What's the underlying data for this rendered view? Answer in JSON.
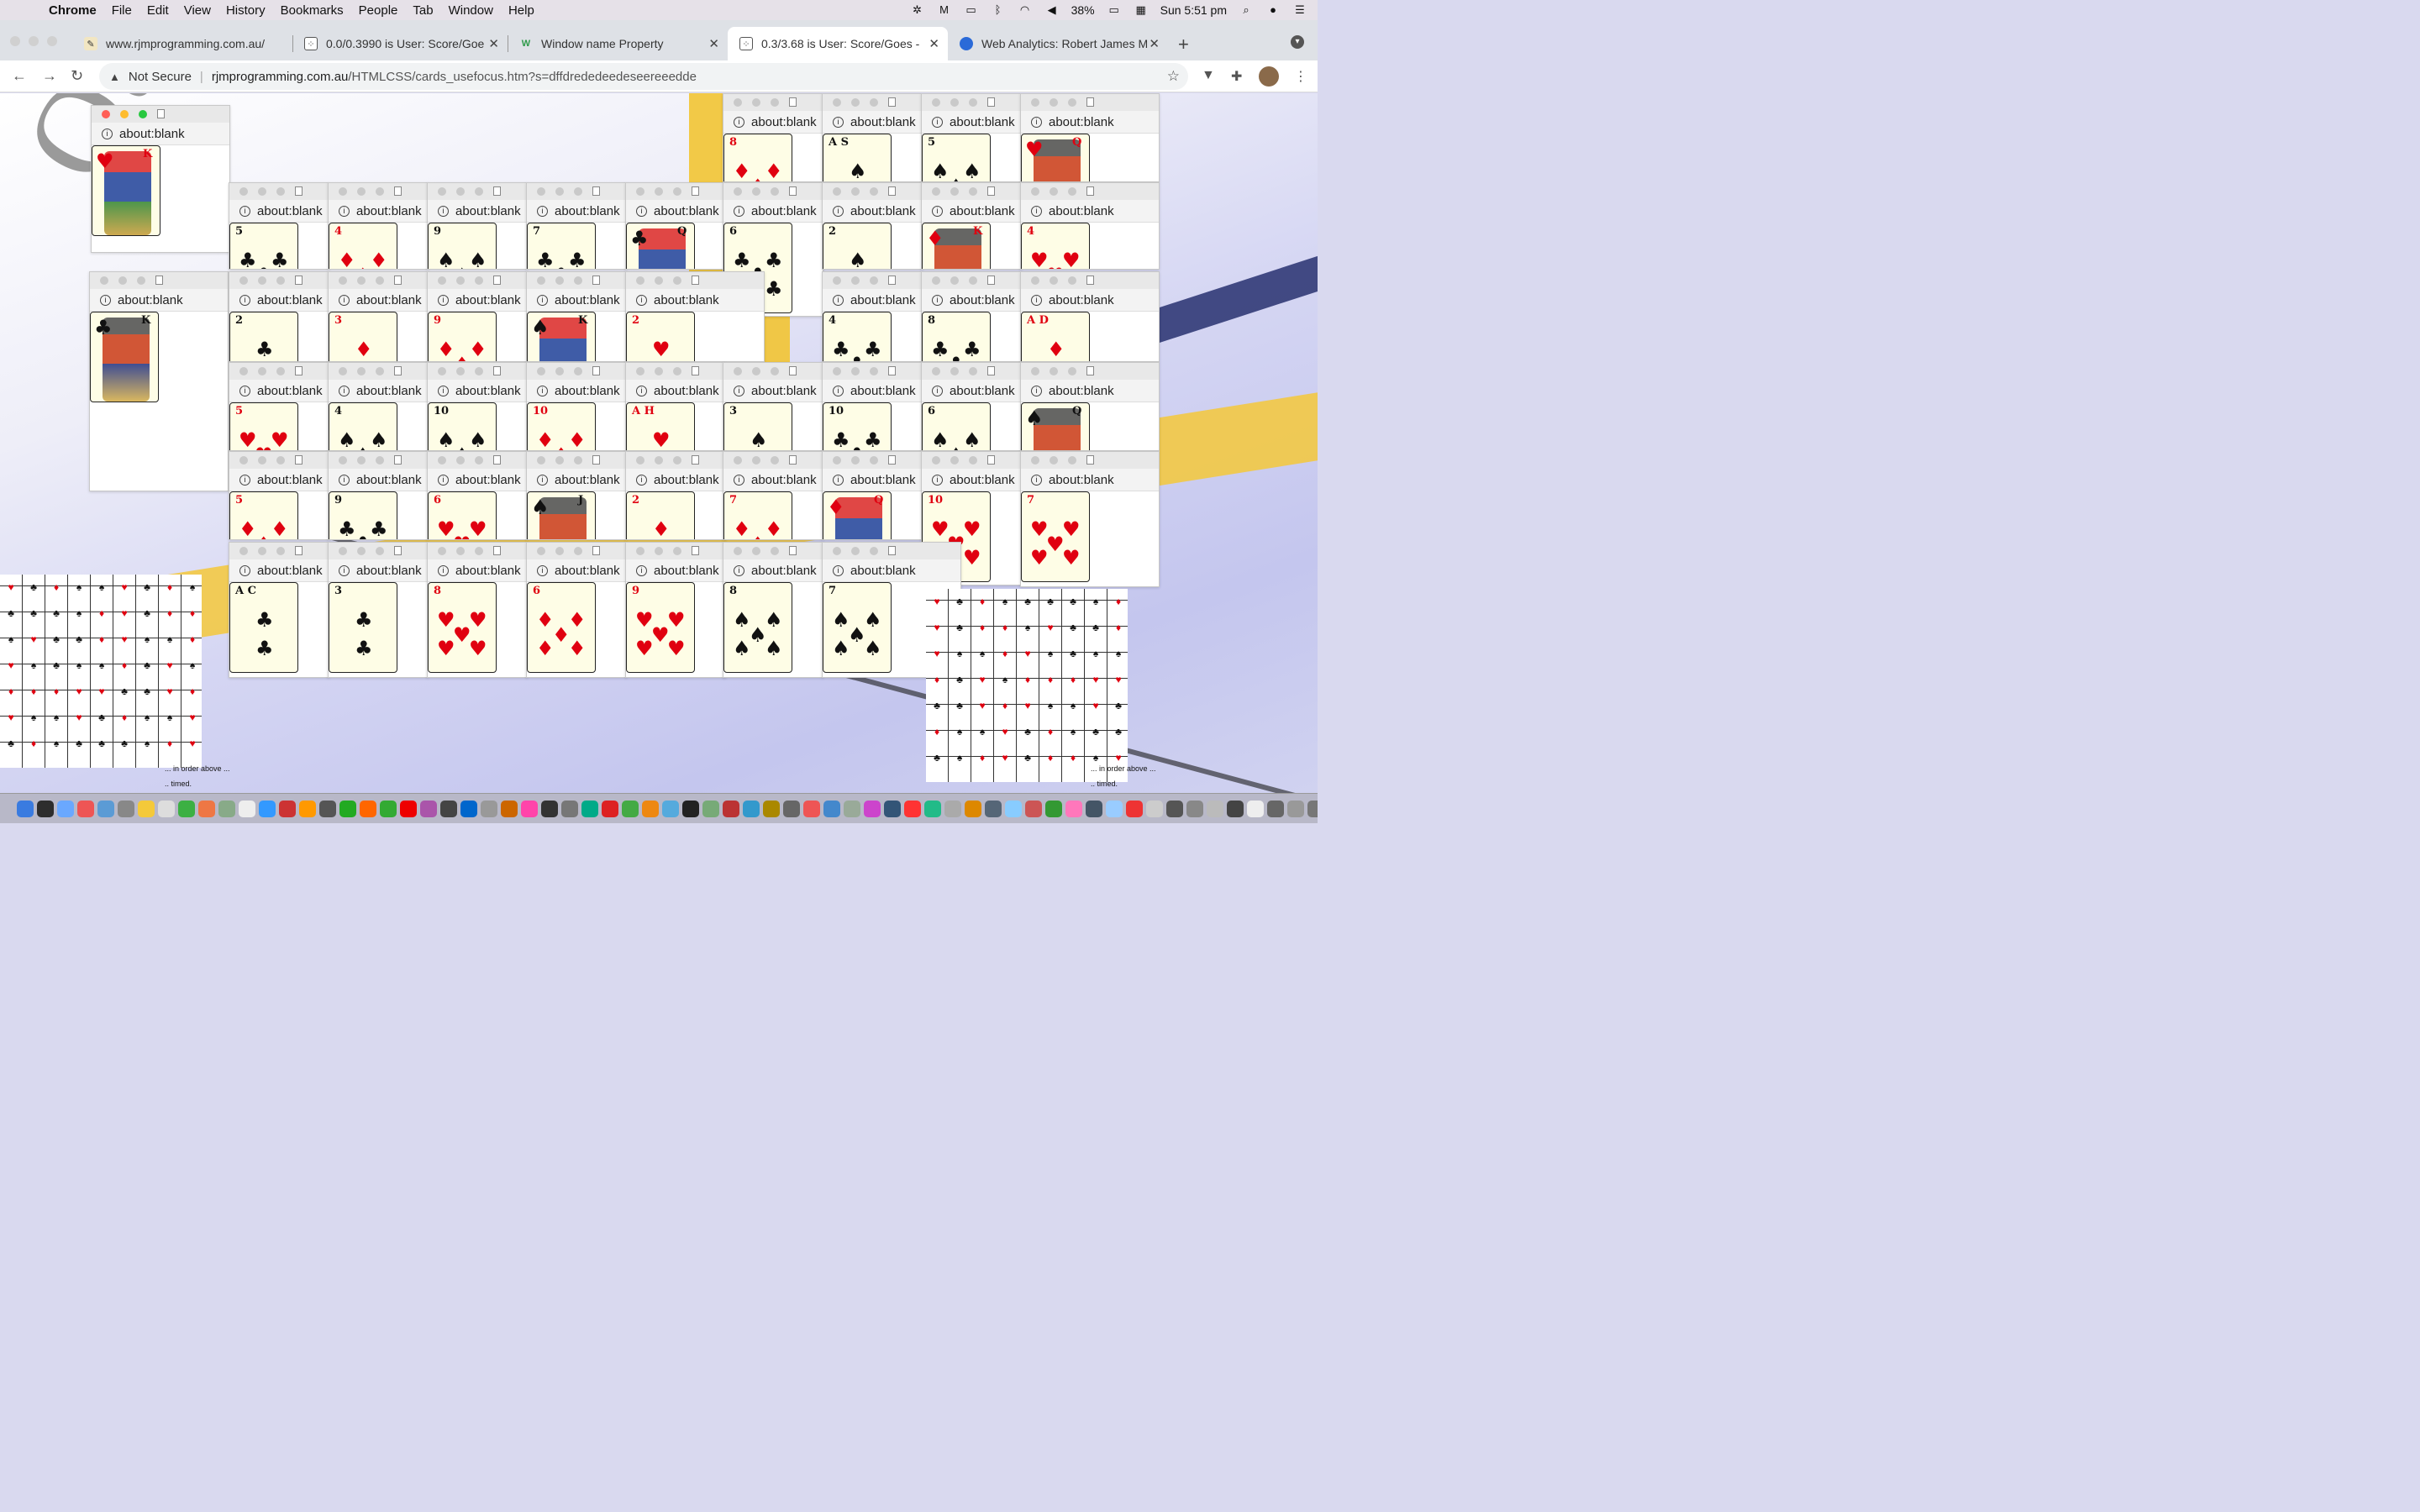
{
  "menubar": {
    "app": "Chrome",
    "items": [
      "File",
      "Edit",
      "View",
      "History",
      "Bookmarks",
      "People",
      "Tab",
      "Window",
      "Help"
    ],
    "battery": "38%",
    "clock": "Sun 5:51 pm",
    "icons": [
      "apple-icon",
      "creative-cloud-icon",
      "malwarebytes-icon",
      "airplay-icon",
      "bluetooth-icon",
      "wifi-icon",
      "volume-icon",
      "battery-icon",
      "calendar-icon",
      "spotlight-icon",
      "siri-icon",
      "control-center-icon"
    ]
  },
  "tabs": [
    {
      "title": "www.rjmprogramming.com.au/",
      "favicon": "pencil-icon",
      "active": false
    },
    {
      "title": "0.0/0.3990 is User: Score/Goe",
      "favicon": "cards-icon",
      "active": false
    },
    {
      "title": "Window name Property",
      "favicon": "w3schools-icon",
      "active": false
    },
    {
      "title": "0.3/3.68 is User: Score/Goes -",
      "favicon": "cards-icon",
      "active": true
    },
    {
      "title": "Web Analytics: Robert James M",
      "favicon": "analytics-icon",
      "active": false
    }
  ],
  "toolbar": {
    "security": "Not Secure",
    "url_host": "rjmprogramming.com.au",
    "url_path": "/HTMLCSS/cards_usefocus.htm?s=dffdrededeedeseereeedde"
  },
  "popup_label": "about:blank",
  "cards": [
    {
      "rank": "K",
      "suit": "♥",
      "face": true
    },
    {
      "rank": "K",
      "suit": "♣",
      "face": true
    },
    {
      "rank": "8",
      "suit": "♦"
    },
    {
      "rank": "A S",
      "suit": "♠"
    },
    {
      "rank": "5",
      "suit": "♠"
    },
    {
      "rank": "Q",
      "suit": "♥",
      "face": true
    },
    {
      "rank": "5",
      "suit": "♣"
    },
    {
      "rank": "4",
      "suit": "♦"
    },
    {
      "rank": "9",
      "suit": "♠"
    },
    {
      "rank": "7",
      "suit": "♣"
    },
    {
      "rank": "Q",
      "suit": "♣",
      "face": true
    },
    {
      "rank": "6",
      "suit": "♣"
    },
    {
      "rank": "2",
      "suit": "♠"
    },
    {
      "rank": "K",
      "suit": "♦",
      "face": true
    },
    {
      "rank": "4",
      "suit": "♥"
    },
    {
      "rank": "2",
      "suit": "♣"
    },
    {
      "rank": "3",
      "suit": "♦"
    },
    {
      "rank": "9",
      "suit": "♦"
    },
    {
      "rank": "K",
      "suit": "♠",
      "face": true
    },
    {
      "rank": "2",
      "suit": "♥"
    },
    {
      "rank": "4",
      "suit": "♣"
    },
    {
      "rank": "8",
      "suit": "♣"
    },
    {
      "rank": "A D",
      "suit": "♦"
    },
    {
      "rank": "5",
      "suit": "♥"
    },
    {
      "rank": "4",
      "suit": "♠"
    },
    {
      "rank": "10",
      "suit": "♠"
    },
    {
      "rank": "10",
      "suit": "♦"
    },
    {
      "rank": "A H",
      "suit": "♥"
    },
    {
      "rank": "3",
      "suit": "♠"
    },
    {
      "rank": "10",
      "suit": "♣"
    },
    {
      "rank": "6",
      "suit": "♠"
    },
    {
      "rank": "Q",
      "suit": "♠",
      "face": true
    },
    {
      "rank": "5",
      "suit": "♦"
    },
    {
      "rank": "9",
      "suit": "♣"
    },
    {
      "rank": "6",
      "suit": "♥"
    },
    {
      "rank": "J",
      "suit": "♠",
      "face": true
    },
    {
      "rank": "2",
      "suit": "♦"
    },
    {
      "rank": "7",
      "suit": "♦"
    },
    {
      "rank": "Q",
      "suit": "♦",
      "face": true
    },
    {
      "rank": "10",
      "suit": "♥"
    },
    {
      "rank": "7",
      "suit": "♥"
    },
    {
      "rank": "A C",
      "suit": "♣"
    },
    {
      "rank": "3",
      "suit": "♣"
    },
    {
      "rank": "8",
      "suit": "♥"
    },
    {
      "rank": "6",
      "suit": "♦"
    },
    {
      "rank": "9",
      "suit": "♥"
    },
    {
      "rank": "8",
      "suit": "♠"
    },
    {
      "rank": "7",
      "suit": "♠"
    }
  ],
  "mosaic_captions": {
    "line1": "... in order above ...",
    "line2": ".. timed."
  },
  "colors": {
    "red_suit": "#e00010",
    "black_suit": "#111111",
    "card_bg": "#fefde6"
  }
}
